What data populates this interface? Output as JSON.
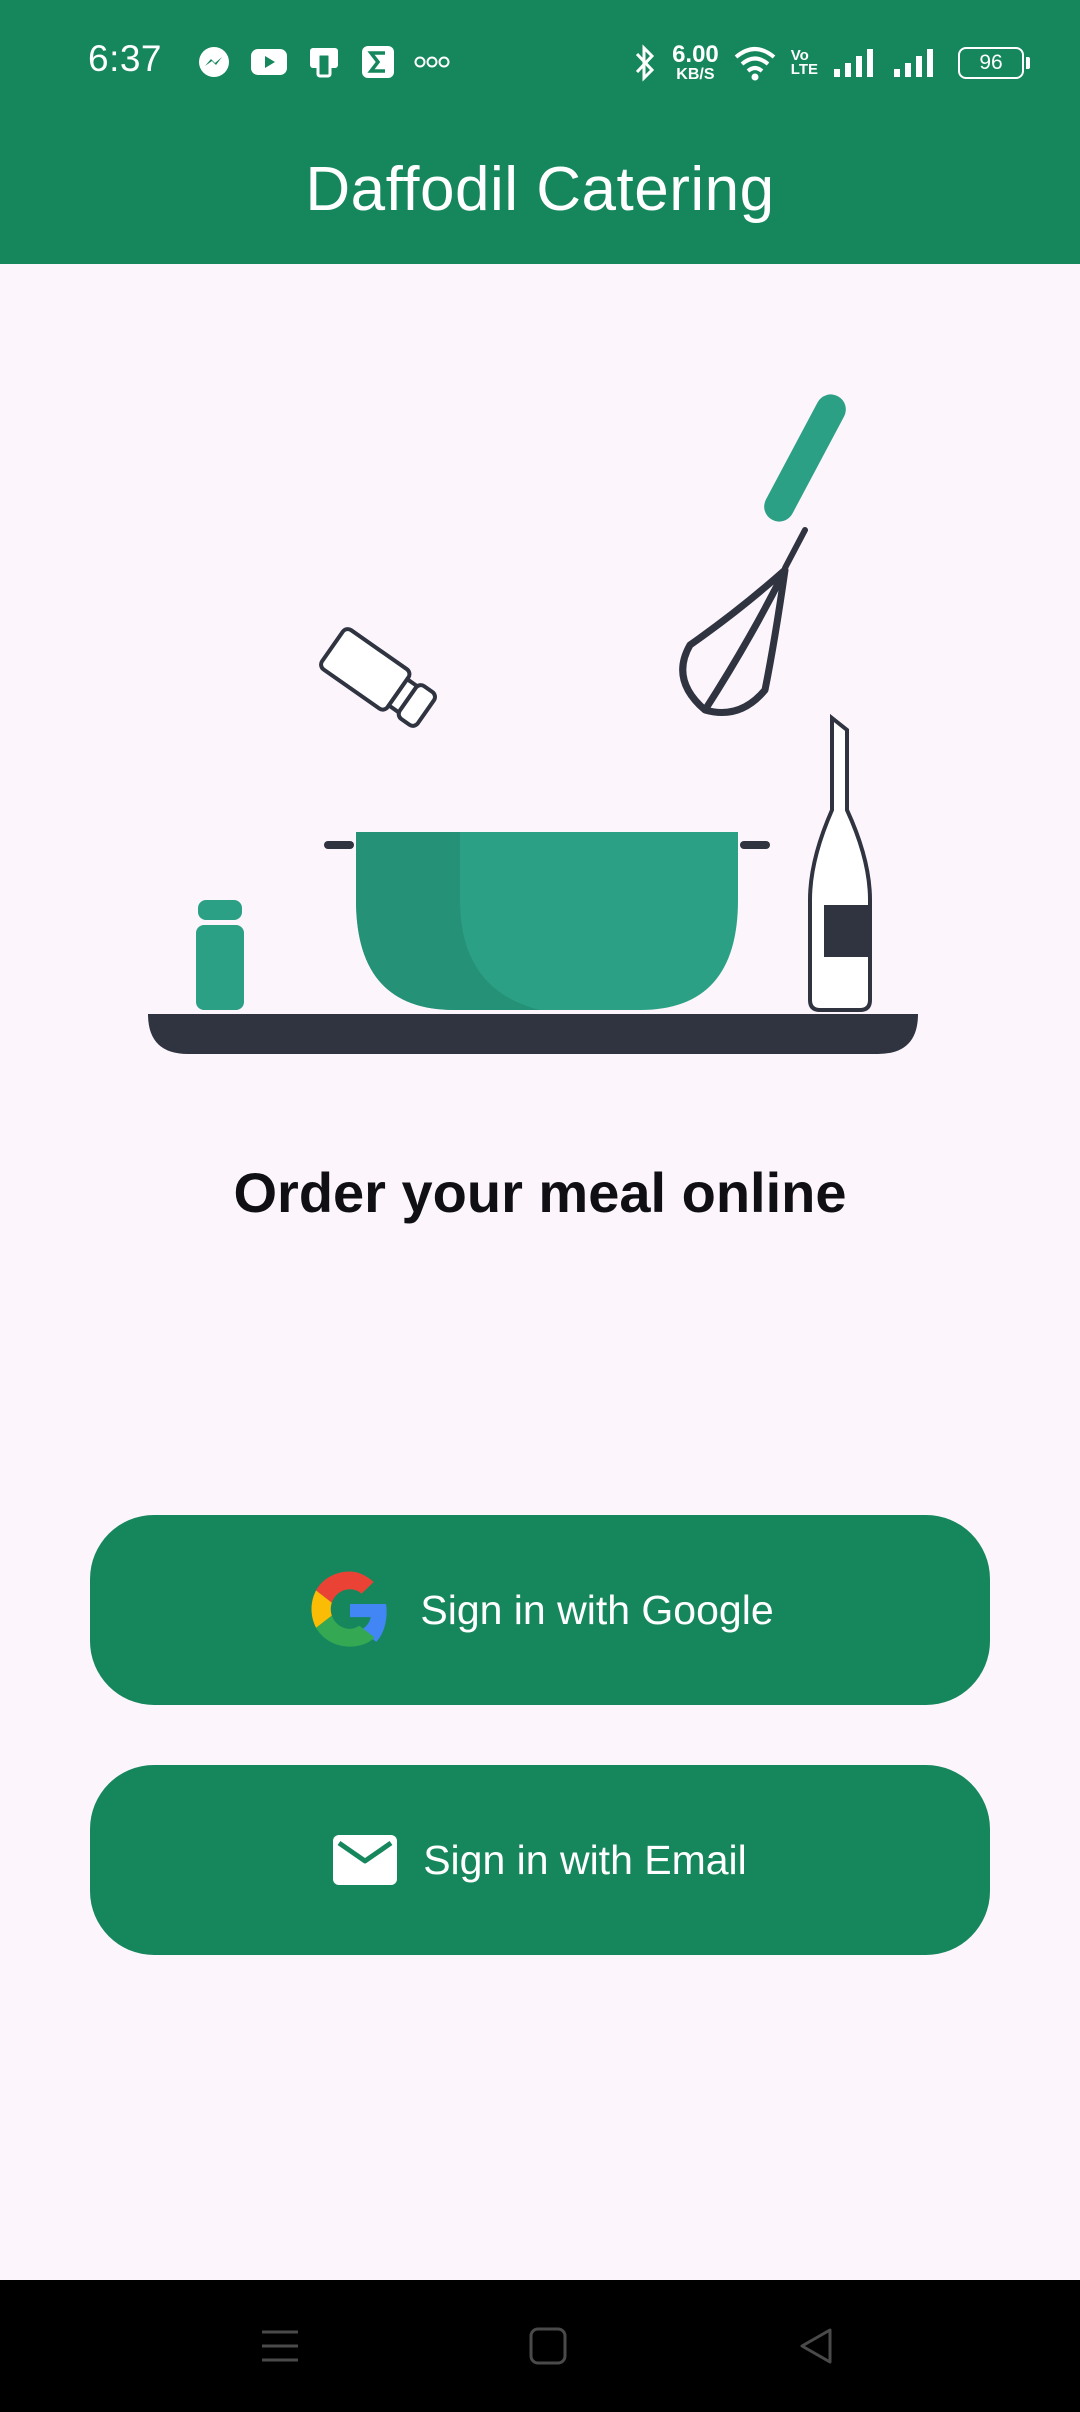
{
  "status_bar": {
    "time": "6:37",
    "left_icons": [
      "messenger-icon",
      "youtube-icon",
      "notification-icon",
      "sigma-icon",
      "more-dots-icon"
    ],
    "net_speed_value": "6.00",
    "net_speed_unit": "KB/S",
    "volte_line1": "Vo",
    "volte_line2": "LTE",
    "battery": "96"
  },
  "app_bar": {
    "title": "Daffodil Catering"
  },
  "main": {
    "tagline": "Order your meal online",
    "google_button_label": "Sign in with Google",
    "email_button_label": "Sign in with Email"
  },
  "colors": {
    "primary": "#16875d",
    "background": "#fcf5fc",
    "illustration_accent": "#2ca085",
    "illustration_dark": "#2f3440"
  },
  "nav_bar": {
    "icons": [
      "menu-icon",
      "home-icon",
      "back-icon"
    ]
  }
}
